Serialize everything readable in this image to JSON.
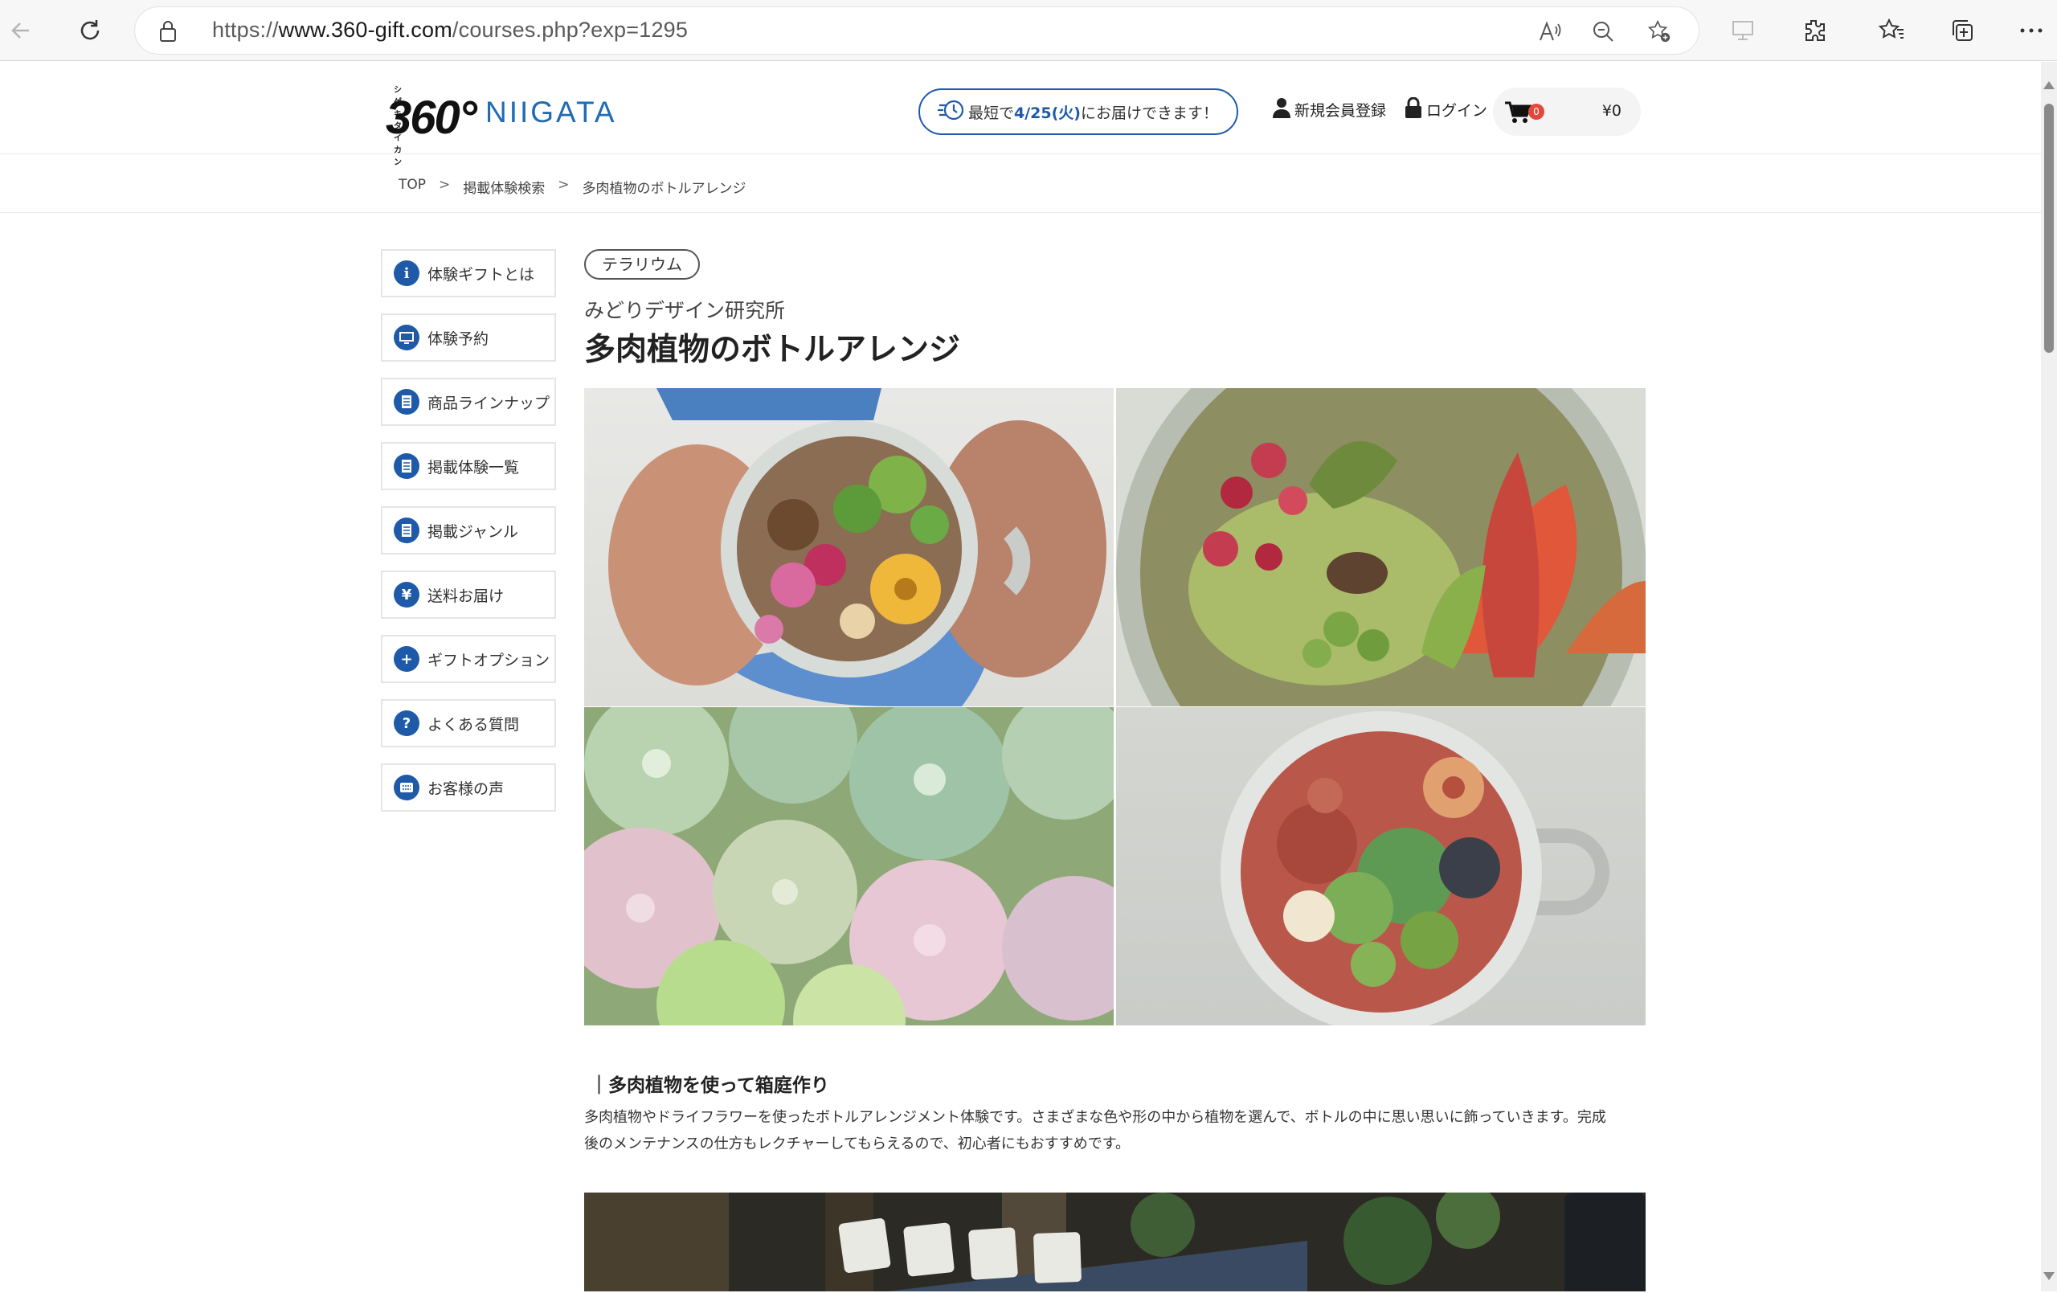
{
  "browser": {
    "url_prefix": "https://",
    "url_domain": "www.360-gift.com",
    "url_path": "/courses.php?exp=1295"
  },
  "header": {
    "logo_small": "シゲキ、タイカン",
    "logo_number": "360°",
    "region": "NIIGATA",
    "delivery_prefix": "最短で",
    "delivery_date": "4/25(火)",
    "delivery_suffix": "にお届けできます！",
    "register_label": "新規会員登録",
    "login_label": "ログイン",
    "cart_count": "0",
    "cart_total": "¥0"
  },
  "breadcrumb": {
    "items": [
      "TOP",
      "掲載体験検索",
      "多肉植物のボトルアレンジ"
    ],
    "separator": ">"
  },
  "sidebar": {
    "items": [
      {
        "label": "体験ギフトとは",
        "icon": "i"
      },
      {
        "label": "体験予約",
        "icon": "▭"
      },
      {
        "label": "商品ラインナップ",
        "icon": "≣"
      },
      {
        "label": "掲載体験一覧",
        "icon": "≣"
      },
      {
        "label": "掲載ジャンル",
        "icon": "≣"
      },
      {
        "label": "送料お届け",
        "icon": "¥"
      },
      {
        "label": "ギフトオプション",
        "icon": "+"
      },
      {
        "label": "よくある質問",
        "icon": "?"
      },
      {
        "label": "お客様の声",
        "icon": "▤"
      }
    ]
  },
  "main": {
    "tag": "テラリウム",
    "shop_name": "みどりデザイン研究所",
    "title": "多肉植物のボトルアレンジ",
    "section_heading": "｜多肉植物を使って箱庭作り",
    "description_line1": "多肉植物やドライフラワーを使ったボトルアレンジメント体験です。さまざまな色や形の中から植物を選んで、ボトルの中に思い思いに飾っていきます。完成",
    "description_line2": "後のメンテナンスの仕方もレクチャーしてもらえるので、初心者にもおすすめです。"
  },
  "colors": {
    "brand_blue": "#1e5aa8",
    "logo_blue": "#1f6bb5",
    "badge_red": "#e4483c"
  }
}
